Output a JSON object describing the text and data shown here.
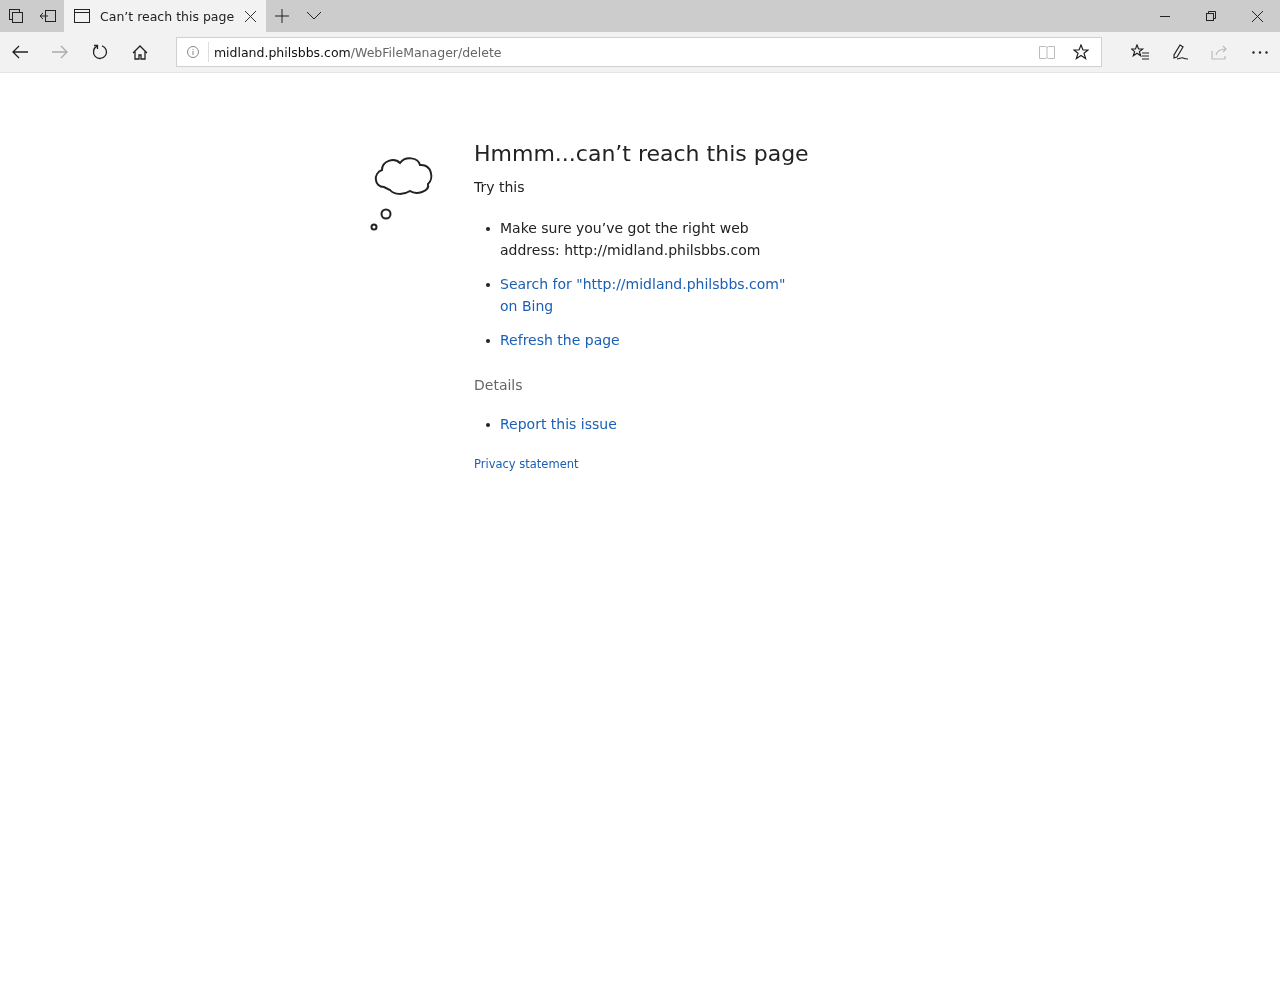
{
  "tab": {
    "title": "Can’t reach this page",
    "selected": true
  },
  "address": {
    "host": "midland.philsbbs.com",
    "path": "/WebFileManager/delete"
  },
  "error": {
    "heading": "Hmmm...can’t reach this page",
    "subheading": "Try this",
    "suggestions": [
      {
        "kind": "text",
        "text": "Make sure you’ve got the right web address: http://midland.philsbbs.com"
      },
      {
        "kind": "link",
        "text": "Search for \"http://midland.philsbbs.com\" on Bing"
      },
      {
        "kind": "link",
        "text": "Refresh the page"
      }
    ],
    "details_heading": "Details",
    "details": [
      {
        "kind": "link",
        "text": "Report this issue"
      }
    ],
    "footer_link": "Privacy statement"
  }
}
